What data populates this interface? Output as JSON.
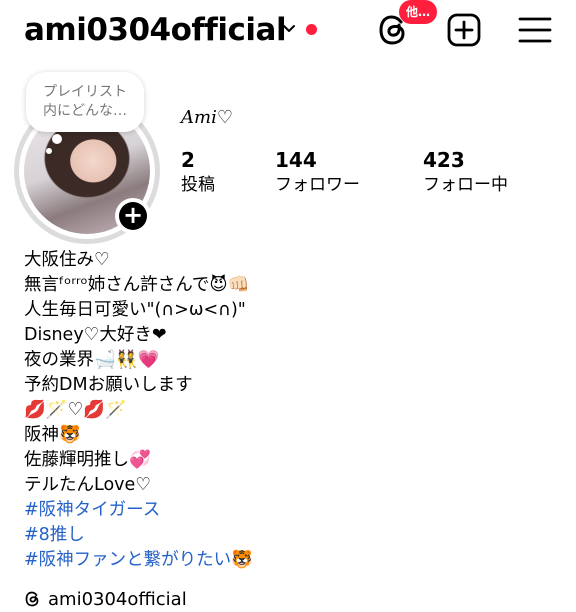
{
  "header": {
    "username": "ami0304official",
    "threads_badge": "他…"
  },
  "note": {
    "line1": "プレイリスト",
    "line2": "内にどんな…"
  },
  "profile": {
    "display_name": "𝐴𝑚𝑖♡",
    "stats": [
      {
        "value": "2",
        "label": "投稿"
      },
      {
        "value": "144",
        "label": "フォロワー"
      },
      {
        "value": "423",
        "label": "フォロー中"
      }
    ]
  },
  "bio": {
    "lines": [
      "大阪住み♡",
      "無言ᶠᵒʳʳᵒ姉さん許さんで😈👊🏻",
      "人生毎日可愛い\"(∩>ω<∩)\"",
      "Disney♡大好き❤",
      "夜の業界🛁👯💗",
      "予約DMお願いします",
      "💋🪄♡💋🪄",
      "阪神🐯",
      "佐藤輝明推し💞",
      "テルたんLove♡"
    ],
    "hashtags": [
      "#阪神タイガース",
      "#8推し",
      "#阪神ファンと繋がりたい🐯"
    ]
  },
  "threads_link": "ami0304official",
  "colors": {
    "notification_red": "#ff1f3d",
    "hashtag_blue": "#2563c9"
  }
}
